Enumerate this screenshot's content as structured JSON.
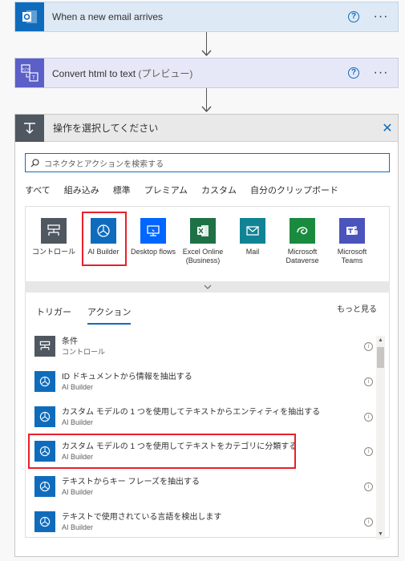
{
  "steps": [
    {
      "title": "When a new email arrives",
      "subtitle": "",
      "icon": "outlook-icon",
      "color": "#0f6cbd"
    },
    {
      "title": "Convert html to text",
      "subtitle": "(プレビュー)",
      "icon": "html-to-text-icon",
      "color": "#5b5fc7"
    }
  ],
  "picker": {
    "title": "操作を選択してください",
    "search_placeholder": "コネクタとアクションを検索する",
    "tabs": [
      "すべて",
      "組み込み",
      "標準",
      "プレミアム",
      "カスタム",
      "自分のクリップボード"
    ],
    "connectors": [
      {
        "label": "コントロール",
        "icon": "control-icon",
        "color": "#4f5760"
      },
      {
        "label": "AI Builder",
        "icon": "ai-builder-icon",
        "color": "#0f6cbd"
      },
      {
        "label": "Desktop flows",
        "icon": "desktop-flows-icon",
        "color": "#0066ff"
      },
      {
        "label": "Excel Online (Business)",
        "icon": "excel-icon",
        "color": "#1e7145"
      },
      {
        "label": "Mail",
        "icon": "mail-icon",
        "color": "#108494"
      },
      {
        "label": "Microsoft Dataverse",
        "icon": "dataverse-icon",
        "color": "#1a8a3e"
      },
      {
        "label": "Microsoft Teams",
        "icon": "teams-icon",
        "color": "#4b53bc"
      }
    ],
    "subtabs": [
      "トリガー",
      "アクション"
    ],
    "see_more": "もっと見る",
    "actions": [
      {
        "title": "条件",
        "subtitle": "コントロール",
        "icon": "condition-icon",
        "color": "#4f5760"
      },
      {
        "title": "ID ドキュメントから情報を抽出する",
        "subtitle": "AI Builder",
        "icon": "ai-builder-icon",
        "color": "#0f6cbd"
      },
      {
        "title": "カスタム モデルの 1 つを使用してテキストからエンティティを抽出する",
        "subtitle": "AI Builder",
        "icon": "ai-builder-icon",
        "color": "#0f6cbd"
      },
      {
        "title": "カスタム モデルの 1 つを使用してテキストをカテゴリに分類する",
        "subtitle": "AI Builder",
        "icon": "ai-builder-icon",
        "color": "#0f6cbd"
      },
      {
        "title": "テキストからキー フレーズを抽出する",
        "subtitle": "AI Builder",
        "icon": "ai-builder-icon",
        "color": "#0f6cbd"
      },
      {
        "title": "テキストで使用されている言語を検出します",
        "subtitle": "AI Builder",
        "icon": "ai-builder-icon",
        "color": "#0f6cbd"
      }
    ]
  }
}
